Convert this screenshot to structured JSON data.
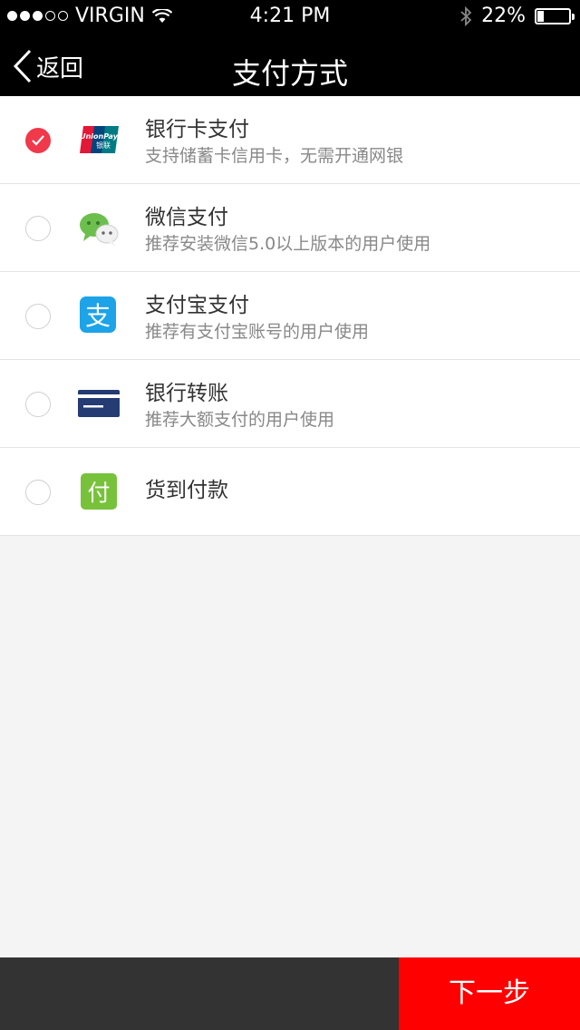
{
  "status_bar": {
    "carrier": "VIRGIN",
    "time": "4:21 PM",
    "battery": "22%",
    "battery_level": 0.22
  },
  "nav": {
    "back_label": "返回",
    "title": "支付方式"
  },
  "payment_methods": [
    {
      "title": "银行卡支付",
      "subtitle": "支持储蓄卡信用卡，无需开通网银",
      "icon": "unionpay-icon",
      "selected": true,
      "logo_line1": "UnionPay",
      "logo_line2": "银联"
    },
    {
      "title": "微信支付",
      "subtitle": "推荐安装微信5.0以上版本的用户使用",
      "icon": "wechat-icon",
      "selected": false
    },
    {
      "title": "支付宝支付",
      "subtitle": "推荐有支付宝账号的用户使用",
      "icon": "alipay-icon",
      "selected": false,
      "glyph": "支"
    },
    {
      "title": "银行转账",
      "subtitle": "推荐大额支付的用户使用",
      "icon": "bank-card-icon",
      "selected": false
    },
    {
      "title": "货到付款",
      "subtitle": "",
      "icon": "cash-on-delivery-icon",
      "selected": false,
      "glyph": "付"
    }
  ],
  "colors": {
    "accent": "#f0394a",
    "next_button": "#ff0000",
    "bottom_bar": "#333333",
    "header": "#000000"
  },
  "footer": {
    "next_label": "下一步"
  }
}
